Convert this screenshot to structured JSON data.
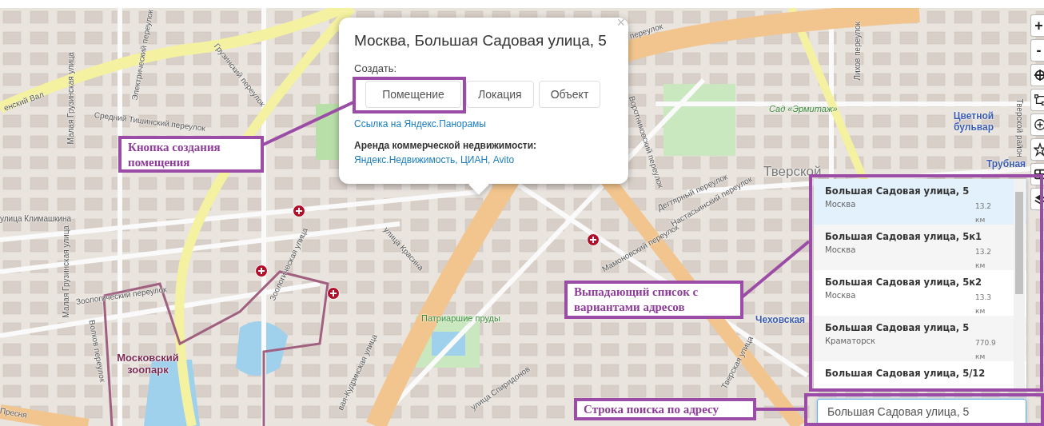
{
  "map": {
    "labels": [
      {
        "text": "енский Вал"
      },
      {
        "text": "Грузинский переулок"
      },
      {
        "text": "Электрический переулок"
      },
      {
        "text": "Средний Тишинский переулок"
      },
      {
        "text": "Малая Грузинская улица"
      },
      {
        "text": "улица Климашкина"
      },
      {
        "text": "Малая Грузинская улица"
      },
      {
        "text": "Зоологический переулок"
      },
      {
        "text": "Зоологическая улица"
      },
      {
        "text": "улица Красина"
      },
      {
        "text": "Московский зоопарк"
      },
      {
        "text": "Волков переулок"
      },
      {
        "text": "Патриаршие пруды"
      },
      {
        "text": "вая-Кудринская улица"
      },
      {
        "text": "Пресня"
      },
      {
        "text": "Мамоновский переулок"
      },
      {
        "text": "Сад «Эрмитаж»"
      },
      {
        "text": "Тверской"
      },
      {
        "text": "Цветной бульвар"
      },
      {
        "text": "Трубная"
      },
      {
        "text": "Тверской район"
      },
      {
        "text": "Воротниковский переулок"
      },
      {
        "text": "Дегтярный переулок"
      },
      {
        "text": "Лихов переулок"
      },
      {
        "text": "Чеховская"
      },
      {
        "text": "улица Спиридонов"
      },
      {
        "text": "Тверская улица"
      },
      {
        "text": "переулок"
      },
      {
        "text": "Настасьинский переулок"
      }
    ],
    "controls": {
      "zoom_in": "+",
      "zoom_out": "-"
    }
  },
  "popup": {
    "title": "Москва, Большая Садовая улица, 5",
    "close": "×",
    "create_label": "Создать:",
    "create_buttons": [
      {
        "label": "Помещение"
      },
      {
        "label": "Локация"
      },
      {
        "label": "Объект"
      }
    ],
    "panorama_link": "Ссылка на Яндекс.Панорамы",
    "rent_heading": "Аренда коммерческой недвижимости:",
    "rent_links": "Яндекс.Недвижимость, ЦИАН, Avito"
  },
  "suggestions": [
    {
      "name": "Большая Садовая улица, 5",
      "city": "Москва",
      "distance": "13.2 км",
      "selected": true
    },
    {
      "name": "Большая Садовая улица, 5к1",
      "city": "Москва",
      "distance": "13.2 км",
      "selected": false
    },
    {
      "name": "Большая Садовая улица, 5к2",
      "city": "Москва",
      "distance": "13.3 км",
      "selected": false
    },
    {
      "name": "Большая Садовая улица, 5",
      "city": "Краматорск",
      "distance": "770.9 км",
      "selected": false
    },
    {
      "name": "Большая Садовая улица, 5/12",
      "selected": false
    }
  ],
  "search": {
    "value": "Большая Садовая улица, 5"
  },
  "annotations": [
    {
      "text": "Кнопка создания помещения"
    },
    {
      "text": "Выпадающий список с вариантами адресов"
    },
    {
      "text": "Строка поиска по адресу"
    }
  ]
}
